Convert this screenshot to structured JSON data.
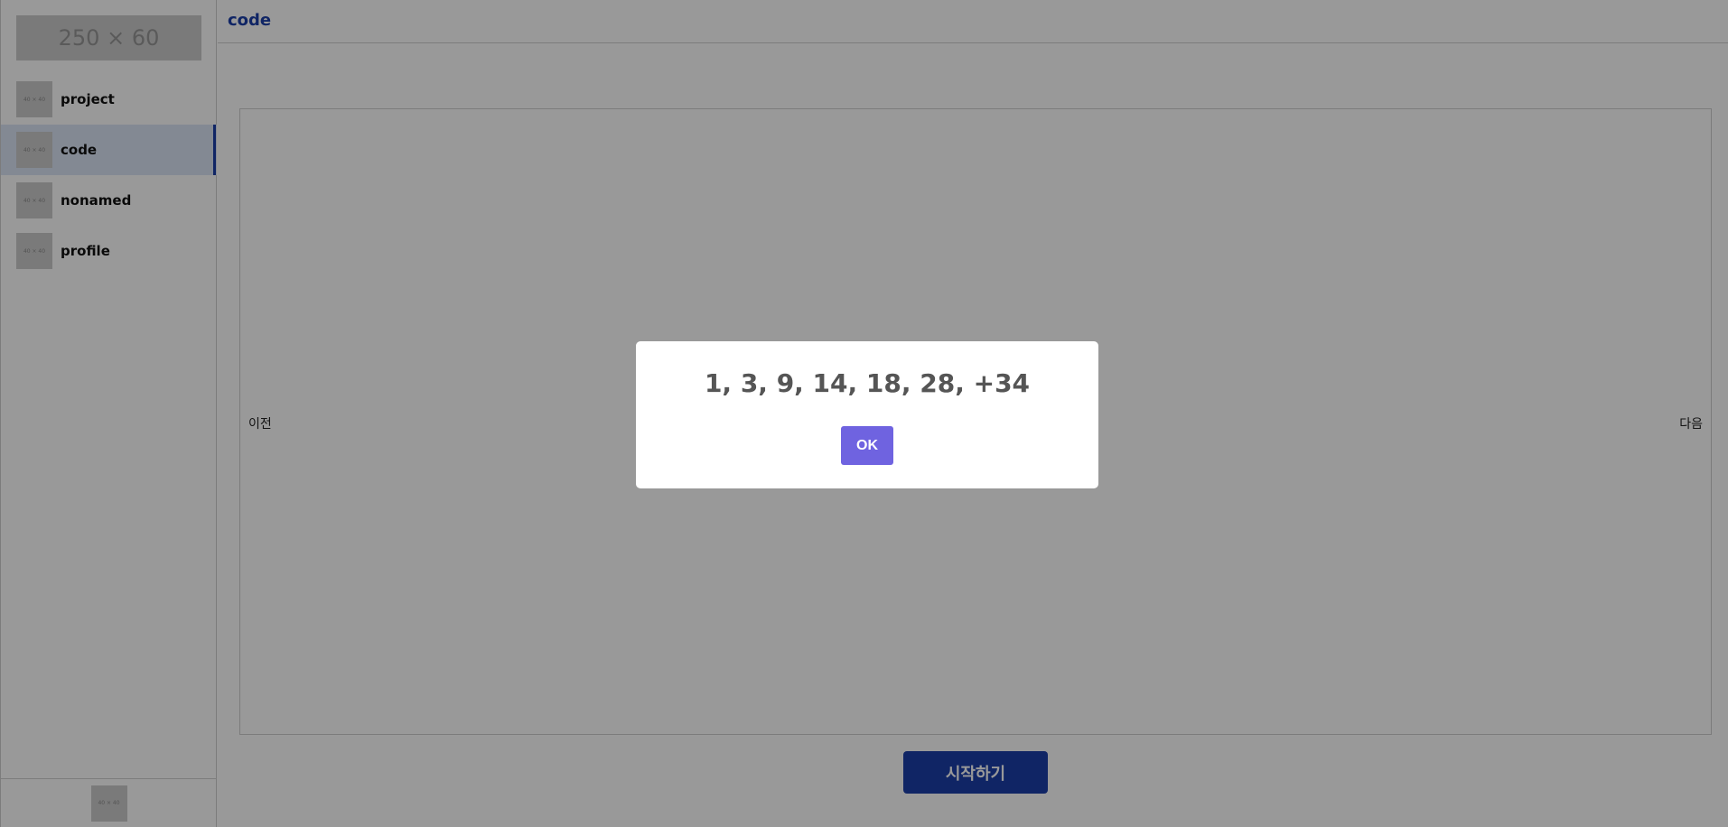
{
  "sidebar": {
    "logo_text": "250 × 60",
    "items": [
      {
        "label": "project",
        "thumb_text": "40 × 40"
      },
      {
        "label": "code",
        "thumb_text": "40 × 40",
        "active": true
      },
      {
        "label": "nonamed",
        "thumb_text": "40 × 40"
      },
      {
        "label": "profile",
        "thumb_text": "40 × 40"
      }
    ],
    "footer_thumb_text": "40 × 40"
  },
  "header": {
    "title": "code"
  },
  "viewer": {
    "prev_label": "이전",
    "next_label": "다음"
  },
  "start_button_label": "시작하기",
  "dialog": {
    "message": "1, 3, 9, 14, 18, 28, +34",
    "ok_label": "OK"
  },
  "colors": {
    "accent": "#1c3fa8",
    "active_bg": "#dbe4f6",
    "dialog_button": "#6f63e0"
  }
}
